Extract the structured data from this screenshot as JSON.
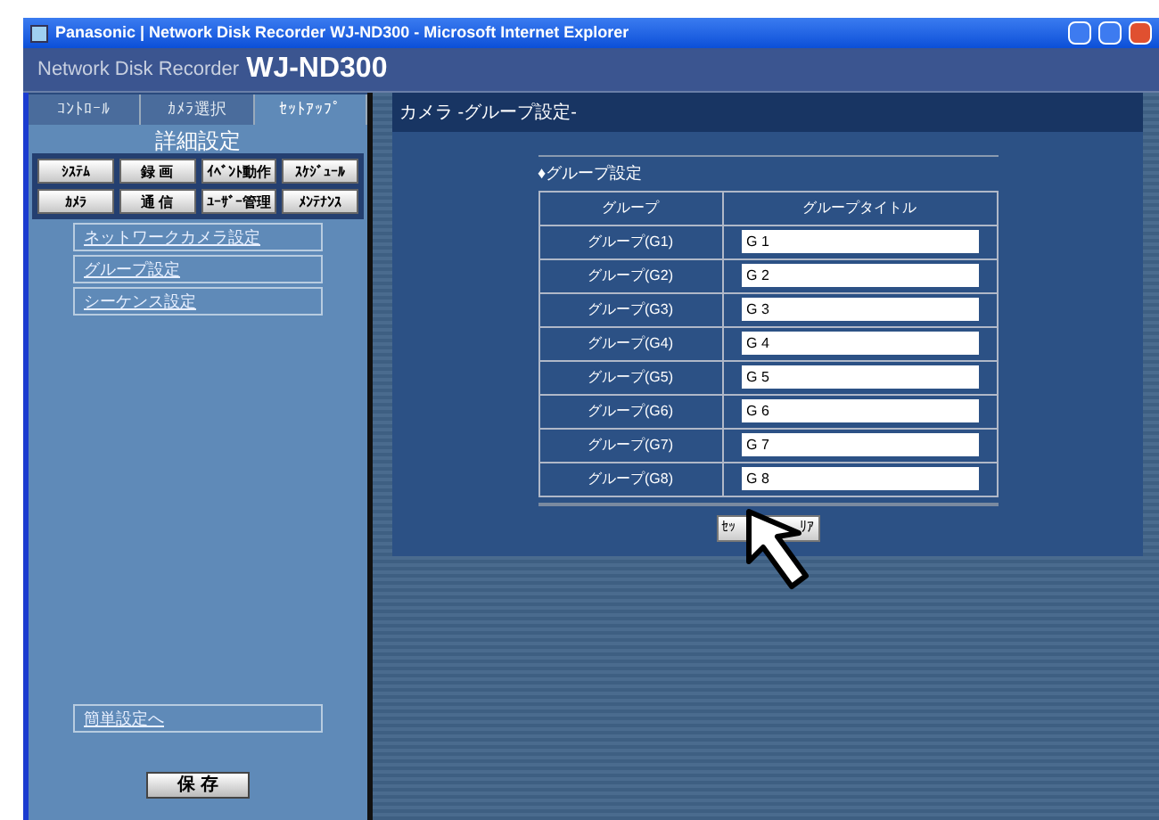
{
  "window": {
    "title": "Panasonic | Network Disk Recorder WJ-ND300 - Microsoft Internet Explorer"
  },
  "header": {
    "subtitle": "Network Disk Recorder",
    "model": "WJ-ND300"
  },
  "tabs": [
    {
      "label": "ｺﾝﾄﾛｰﾙ",
      "selected": false
    },
    {
      "label": "ｶﾒﾗ選択",
      "selected": false
    },
    {
      "label": "ｾｯﾄｱｯﾌﾟ",
      "selected": true
    }
  ],
  "sidebar": {
    "heading": "詳細設定",
    "menu_buttons": [
      "ｼｽﾃﾑ",
      "録 画",
      "ｲﾍﾞﾝﾄ動作",
      "ｽｹｼﾞｭｰﾙ",
      "ｶﾒﾗ",
      "通 信",
      "ﾕｰｻﾞｰ管理",
      "ﾒﾝﾃﾅﾝｽ"
    ],
    "links": [
      "ネットワークカメラ設定",
      "グループ設定",
      "シーケンス設定"
    ],
    "easy_setup_link": "簡単設定へ",
    "save_button": "保 存"
  },
  "page": {
    "title": "カメラ -グループ設定-",
    "section": "♦グループ設定",
    "table": {
      "columns": [
        "グループ",
        "グループタイトル"
      ],
      "rows": [
        {
          "group": "グループ(G1)",
          "title": "G 1"
        },
        {
          "group": "グループ(G2)",
          "title": "G 2"
        },
        {
          "group": "グループ(G3)",
          "title": "G 3"
        },
        {
          "group": "グループ(G4)",
          "title": "G 4"
        },
        {
          "group": "グループ(G5)",
          "title": "G 5"
        },
        {
          "group": "グループ(G6)",
          "title": "G 6"
        },
        {
          "group": "グループ(G7)",
          "title": "G 7"
        },
        {
          "group": "グループ(G8)",
          "title": "G 8"
        }
      ]
    },
    "set_button": {
      "visible_left": "ｾｯ",
      "visible_right": "ﾘｱ"
    }
  }
}
